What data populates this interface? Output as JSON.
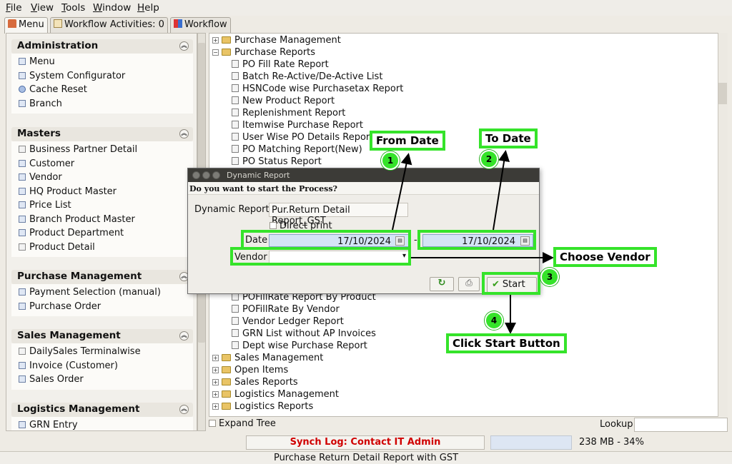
{
  "menubar": {
    "items": [
      "File",
      "View",
      "Tools",
      "Window",
      "Help"
    ]
  },
  "tabs": [
    {
      "label": "Menu",
      "icon": "home-icon"
    },
    {
      "label": "Workflow Activities: 0",
      "icon": "list-icon"
    },
    {
      "label": "Workflow",
      "icon": "workflow-icon"
    }
  ],
  "sidebar": {
    "sections": [
      {
        "title": "Administration",
        "items": [
          "Menu",
          "System Configurator",
          "Cache Reset",
          "Branch"
        ]
      },
      {
        "title": "Masters",
        "items": [
          "Business Partner Detail",
          "Customer",
          "Vendor",
          "HQ Product Master",
          "Price List",
          "Branch Product Master",
          "Product Department",
          "Product Detail"
        ]
      },
      {
        "title": "Purchase Management",
        "items": [
          "Payment Selection (manual)",
          "Purchase Order"
        ]
      },
      {
        "title": "Sales Management",
        "items": [
          "DailySales Terminalwise",
          "Invoice (Customer)",
          "Sales Order"
        ]
      },
      {
        "title": "Logistics Management",
        "items": [
          "GRN Entry"
        ]
      }
    ]
  },
  "tree": {
    "folders_top": [
      "Purchase Management",
      "Purchase Reports"
    ],
    "reports_top": [
      "PO Fill Rate Report",
      "Batch Re-Active/De-Active List",
      "HSNCode wise Purchasetax Report",
      "New Product Report",
      "Replenishment Report",
      "Itemwise Purchase Report",
      "User Wise PO Details Report",
      "PO Matching Report(New)",
      "PO Status Report"
    ],
    "reports_bottom": [
      "POFillRate Report By Product",
      "POFillRate By Vendor",
      "Vendor Ledger Report",
      "GRN List without AP Invoices",
      "Dept wise Purchase Report"
    ],
    "folders_bottom": [
      "Sales Management",
      "Open Items",
      "Sales Reports",
      "Logistics Management",
      "Logistics Reports"
    ]
  },
  "footer": {
    "expand_tree": "Expand Tree",
    "lookup": "Lookup",
    "synch_log": "Synch Log: Contact IT Admin",
    "memory": "238 MB - 34%",
    "status_title": "Purchase Return Detail Report with GST"
  },
  "dialog": {
    "title": "Dynamic Report",
    "message": "Do you want to start the Process?",
    "report_label": "Dynamic Report",
    "report_value": "Pur.Return Detail Report_GST",
    "direct_print": "Direct print",
    "date_label": "Date",
    "date_from": "17/10/2024",
    "date_sep": "-",
    "date_to": "17/10/2024",
    "vendor_label": "Vendor",
    "vendor_value": "",
    "start_label": "Start"
  },
  "annotations": {
    "from_date": "From Date",
    "to_date": "To Date",
    "choose_vendor": "Choose Vendor",
    "click_start": "Click Start Button",
    "steps": [
      "1",
      "2",
      "3",
      "4"
    ],
    "color": "#35e32a"
  }
}
